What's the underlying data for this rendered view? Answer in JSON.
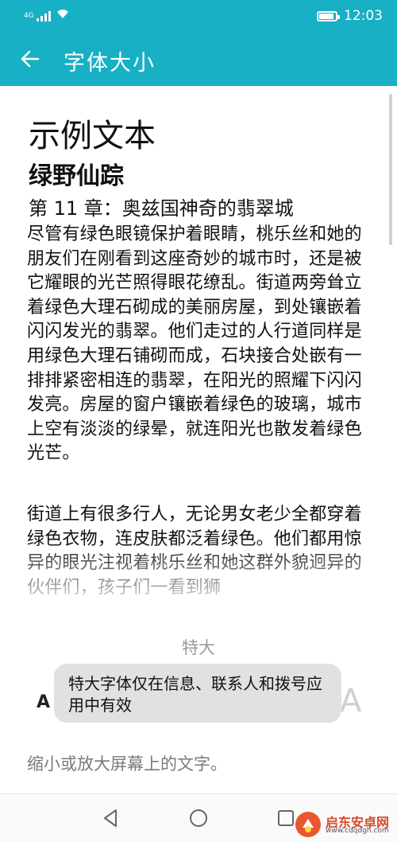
{
  "status_bar": {
    "network": "4G",
    "time": "12:03",
    "battery_level": 0.9
  },
  "app_bar": {
    "title": "字体大小",
    "back_icon": "arrow-left-icon"
  },
  "preview": {
    "sample_title": "示例文本",
    "book_title": "绿野仙踪",
    "chapter": "第 11 章：奥兹国神奇的翡翠城",
    "paragraph1": "尽管有绿色眼镜保护着眼睛，桃乐丝和她的朋友们在刚看到这座奇妙的城市时，还是被它耀眼的光芒照得眼花缭乱。街道两旁耸立着绿色大理石砌成的美丽房屋，到处镶嵌着闪闪发光的翡翠。他们走过的人行道同样是用绿色大理石铺砌而成，石块接合处嵌有一排排紧密相连的翡翠，在阳光的照耀下闪闪发亮。房屋的窗户镶嵌着绿色的玻璃，城市上空有淡淡的绿晕，就连阳光也散发着绿色光芒。",
    "paragraph2": "街道上有很多行人，无论男女老少全都穿着绿色衣物，连皮肤都泛着绿色。他们都用惊异的眼光注视着桃乐丝和她这群外貌迥异的伙伴们，孩子们一看到狮"
  },
  "size_control": {
    "current_size_label": "特大",
    "small_label": "A",
    "large_label": "A",
    "slider_value": 0.95,
    "toast_text": "特大字体仅在信息、联系人和拨号应用中有效",
    "description": "缩小或放大屏幕上的文字。"
  },
  "nav_bar": {
    "back_icon": "triangle-back-icon",
    "home_icon": "circle-home-icon",
    "recent_icon": "square-recent-icon"
  },
  "watermark": {
    "text": "启东安卓网",
    "url": "www.cdqdgh.com"
  },
  "colors": {
    "accent": "#17b0c4",
    "toast_bg": "#e0e0e0"
  }
}
